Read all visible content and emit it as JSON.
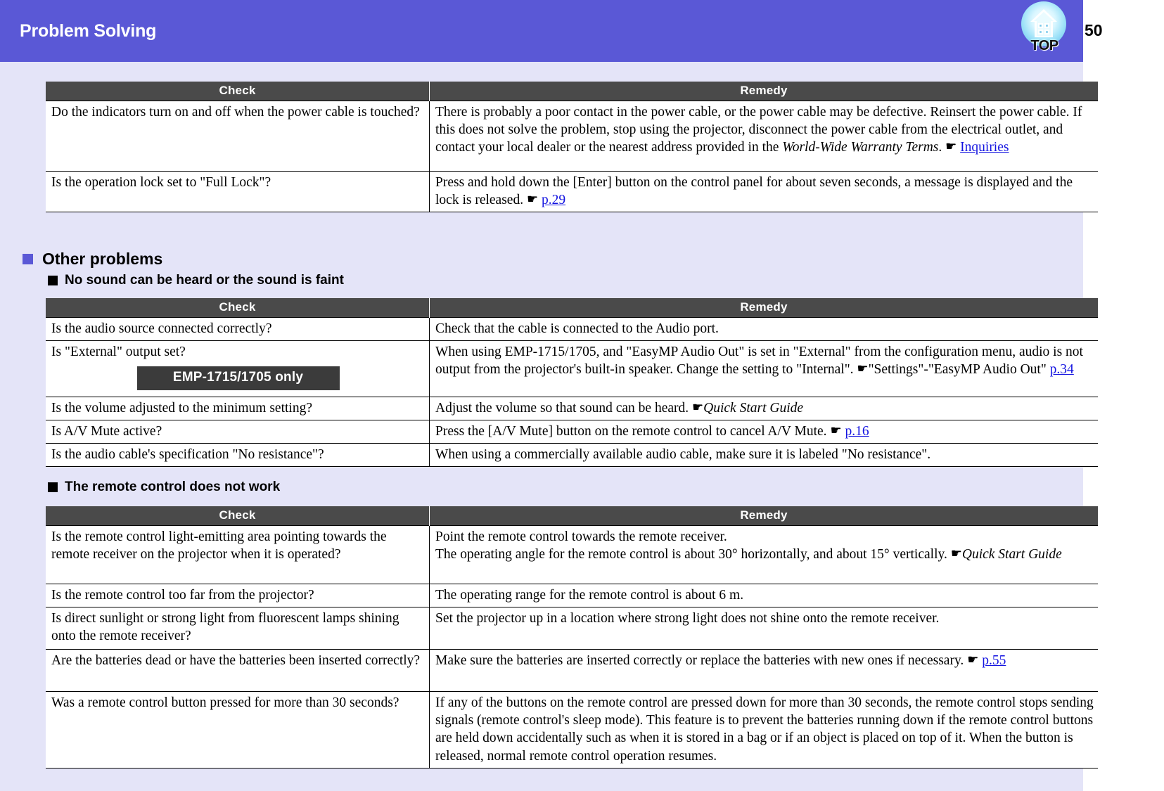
{
  "header": {
    "title": "Problem Solving",
    "page_number": "50",
    "top_icon_label": "TOP",
    "band_color": "#5a58d6"
  },
  "columns": {
    "check": "Check",
    "remedy": "Remedy"
  },
  "table1": {
    "rows": [
      {
        "check": "Do the indicators turn on and off when the power cable is touched?",
        "remedy_pre": "There is probably a poor contact in the power cable, or the power cable may be defective. Reinsert the power cable. If this does not solve the problem, stop using the projector, disconnect the power cable from the electrical outlet, and contact your local dealer or the nearest address provided in the ",
        "remedy_italic": "World-Wide Warranty Terms",
        "remedy_mid": ". ",
        "remedy_link": "Inquiries"
      },
      {
        "check": "Is the operation lock set to \"Full Lock\"?",
        "remedy_pre": "Press and hold down the [Enter] button on the control panel for about seven seconds, a message is displayed and the lock is released. ",
        "remedy_link": "p.29"
      }
    ]
  },
  "section": {
    "heading": "Other problems",
    "sub1": "No sound can be heard or the sound is faint",
    "sub2": "The remote control does not work"
  },
  "table2": {
    "rows": [
      {
        "check": "Is the audio source connected correctly?",
        "badge": null,
        "remedy_pre": "Check that the cable is connected to the Audio port.",
        "remedy_link": null
      },
      {
        "check": "Is \"External\" output set?",
        "badge": "EMP-1715/1705 only",
        "remedy_pre": "When using EMP-1715/1705, and \"EasyMP Audio Out\" is set in \"External\" from the configuration menu, audio is not output from the projector's built-in speaker. Change the setting to \"Internal\". ",
        "remedy_mid": "\"Settings\"-\"EasyMP Audio Out\" ",
        "remedy_link": "p.34"
      },
      {
        "check": "Is the volume adjusted to the minimum setting?",
        "badge": null,
        "remedy_pre": "Adjust the volume so that sound can be heard. ",
        "remedy_italic": "Quick Start Guide",
        "remedy_link": null
      },
      {
        "check": "Is A/V Mute active?",
        "badge": null,
        "remedy_pre": "Press the [A/V Mute] button on the remote control to cancel A/V Mute. ",
        "remedy_link": "p.16"
      },
      {
        "check": "Is the audio cable's specification \"No resistance\"?",
        "badge": null,
        "remedy_pre": "When using a commercially available audio cable, make sure it is labeled \"No resistance\".",
        "remedy_link": null
      }
    ]
  },
  "table3": {
    "rows": [
      {
        "check": "Is the remote control light-emitting area pointing towards the remote receiver on the projector when it is operated?",
        "remedy_line1": "Point the remote control towards the remote receiver.",
        "remedy_line2_pre": "The operating angle for the remote control is about 30° horizontally, and about 15° vertically. ",
        "remedy_line2_italic": "Quick Start Guide",
        "remedy_link": null
      },
      {
        "check": "Is the remote control too far from the projector?",
        "remedy_line1": "The operating range for the remote control is about 6 m.",
        "remedy_link": null
      },
      {
        "check": "Is direct sunlight or strong light from fluorescent lamps shining onto the remote receiver?",
        "remedy_line1": "Set the projector up in a location where strong light does not shine onto the remote receiver.",
        "remedy_link": null
      },
      {
        "check": "Are the batteries dead or have the batteries been inserted correctly?",
        "remedy_line1": "Make sure the batteries are inserted correctly or replace the batteries with new ones if necessary. ",
        "remedy_link": "p.55"
      },
      {
        "check": "Was a remote control button pressed for more than 30 seconds?",
        "remedy_line1": "If any of the buttons on the remote control are pressed down for more than 30 seconds, the remote control stops sending signals (remote control's sleep mode). This feature is to prevent the batteries running down if the remote control buttons are held down accidentally such as when it is stored in a bag or if an object is placed on top of it. When the button is released, normal remote control operation resumes.",
        "remedy_link": null
      }
    ]
  },
  "icons": {
    "pointing_hand": "☛"
  }
}
